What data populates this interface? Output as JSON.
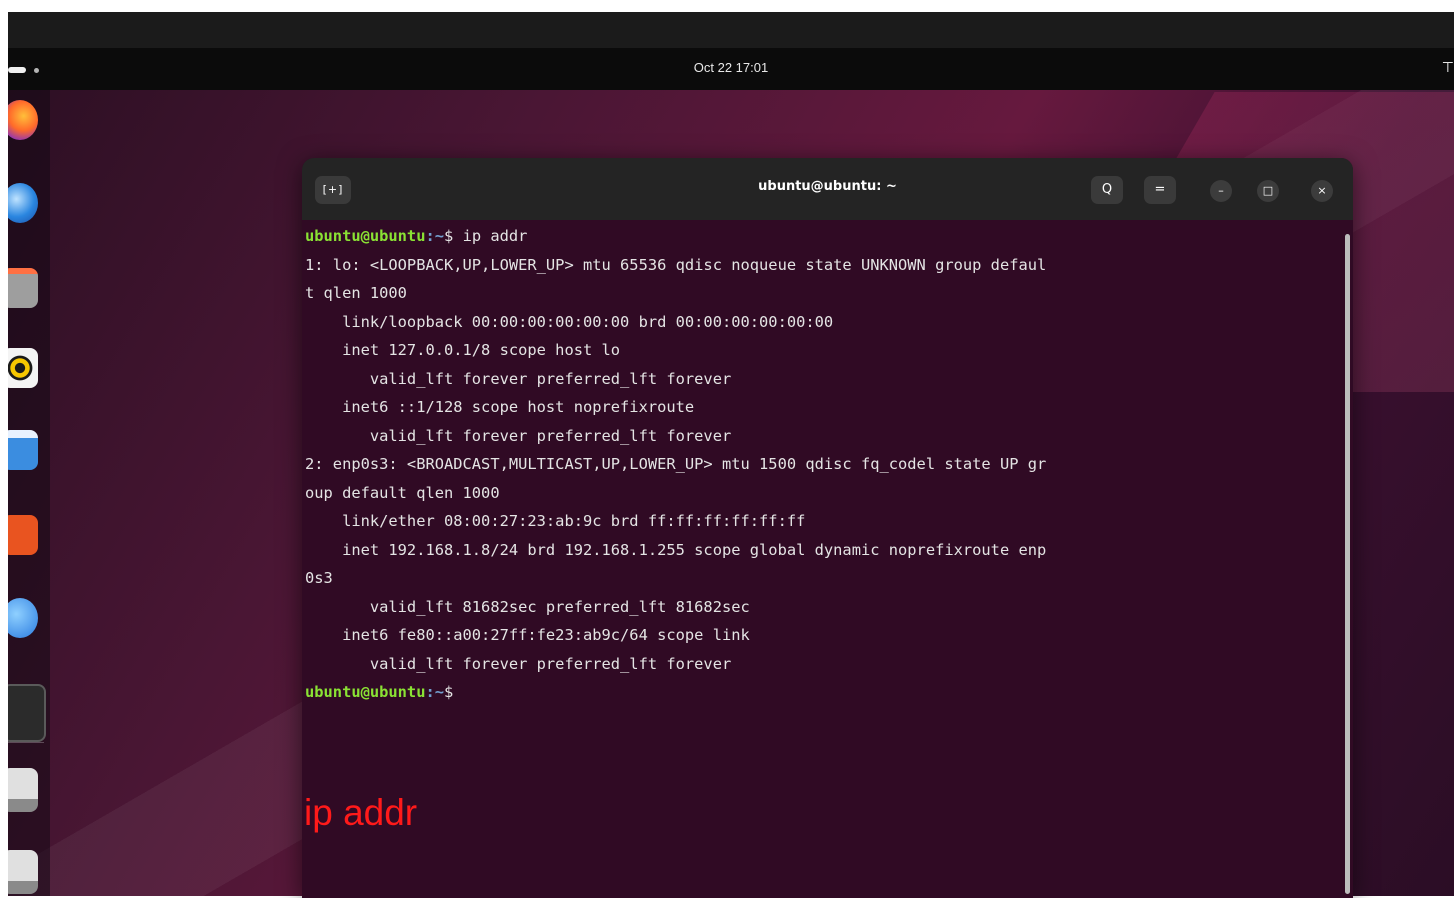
{
  "topbar": {
    "clock": "Oct 22  17:01",
    "tray_icon": "network-icon"
  },
  "dock": {
    "apps": [
      "firefox-icon",
      "thunderbird-icon",
      "files-icon",
      "rhythmbox-icon",
      "writer-icon",
      "app-center-icon",
      "help-icon",
      "terminal-icon",
      "drive-icon",
      "drive-icon"
    ]
  },
  "terminal": {
    "title": "ubuntu@ubuntu: ~",
    "new_tab_label": "[+]",
    "search_icon": "Q",
    "menu_icon": "=",
    "minimize_label": "–",
    "maximize_label": "□",
    "close_label": "×",
    "prompt_user": "ubuntu@ubuntu",
    "prompt_path": ":~",
    "prompt_symbol": "$ ",
    "command": "ip addr",
    "output": [
      "1: lo: <LOOPBACK,UP,LOWER_UP> mtu 65536 qdisc noqueue state UNKNOWN group defaul",
      "t qlen 1000",
      "    link/loopback 00:00:00:00:00:00 brd 00:00:00:00:00:00",
      "    inet 127.0.0.1/8 scope host lo",
      "       valid_lft forever preferred_lft forever",
      "    inet6 ::1/128 scope host noprefixroute",
      "       valid_lft forever preferred_lft forever",
      "2: enp0s3: <BROADCAST,MULTICAST,UP,LOWER_UP> mtu 1500 qdisc fq_codel state UP gr",
      "oup default qlen 1000",
      "    link/ether 08:00:27:23:ab:9c brd ff:ff:ff:ff:ff:ff",
      "    inet 192.168.1.8/24 brd 192.168.1.255 scope global dynamic noprefixroute enp",
      "0s3",
      "       valid_lft 81682sec preferred_lft 81682sec",
      "    inet6 fe80::a00:27ff:fe23:ab9c/64 scope link",
      "       valid_lft forever preferred_lft forever"
    ]
  },
  "overlay_label": "ip addr",
  "colors": {
    "terminal_bg": "#300a24",
    "prompt_user": "#8ae234",
    "prompt_path": "#729fcf",
    "overlay": "#ff1a1a"
  }
}
